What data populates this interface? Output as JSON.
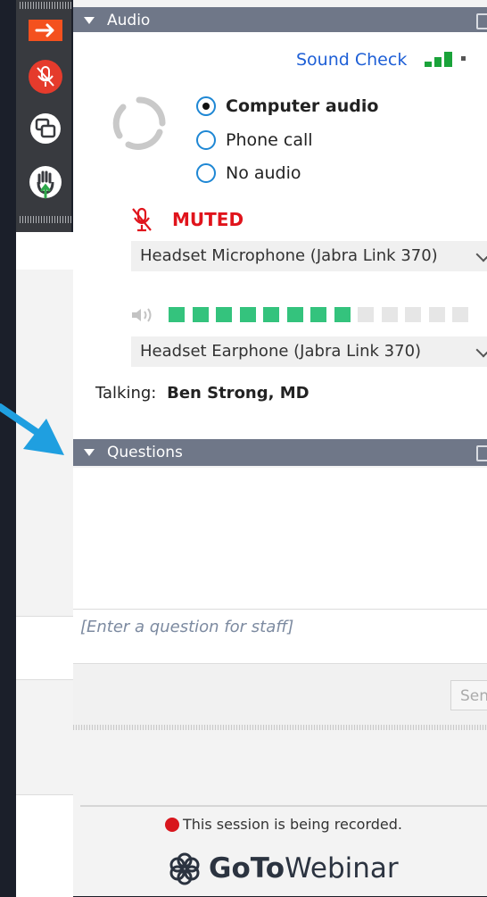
{
  "toolbar": {
    "icons": [
      "arrow-right-icon",
      "mic-muted-icon",
      "screen-share-icon",
      "raise-hand-icon"
    ]
  },
  "audio": {
    "title": "Audio",
    "sound_check": "Sound Check",
    "options": [
      {
        "label": "Computer audio",
        "selected": true
      },
      {
        "label": "Phone call",
        "selected": false
      },
      {
        "label": "No audio",
        "selected": false
      }
    ],
    "mute_status": "MUTED",
    "microphone": "Headset Microphone (Jabra Link 370)",
    "speaker": "Headset Earphone (Jabra Link 370)",
    "output_level": {
      "active_bars": 8,
      "total_bars": 13
    },
    "talking_label": "Talking:",
    "talking_name": "Ben Strong, MD"
  },
  "questions": {
    "title": "Questions",
    "placeholder": "[Enter a question for staff]",
    "send_label": "Send"
  },
  "footer": {
    "recording_text": "This session is being recorded.",
    "brand_goto": "GoTo",
    "brand_webinar": "Webinar"
  },
  "colors": {
    "header_bg": "#6f7788",
    "accent_blue": "#1e87d4",
    "muted_red": "#e0141c",
    "meter_green": "#34c37d",
    "annotation_arrow": "#1f9fe0"
  }
}
